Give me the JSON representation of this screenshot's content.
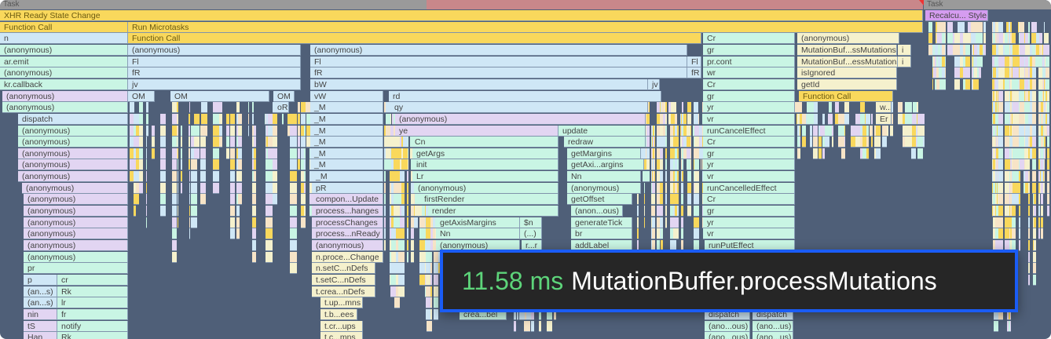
{
  "palette": {
    "yellow": "#f9d85c",
    "blue": "#cfe7f6",
    "green": "#c9f5e4",
    "purple": "#e2d5f2",
    "lightyellow": "#f5f1cd",
    "beige": "#f7e4c7",
    "background": "#4f5f78",
    "task_gray": "#9a9a9a",
    "long_task_red": "#c9878a",
    "style_purple": "#d59cf0",
    "tooltip_border": "#1a5cf5",
    "tooltip_time": "#5dd47a"
  },
  "task_row": {
    "left": "Task",
    "right": "Task"
  },
  "blocks": [
    "XHR Ready State Change",
    "Recalcu... Style",
    "Function Call",
    "Run Microtasks",
    "n",
    "Function Call",
    "Cr",
    "(anonymous)",
    "(anonymous)",
    "(anonymous)",
    "(anonymous)",
    "gr",
    "MutationBuf...ssMutations",
    "i",
    "ar.emit",
    "Fl",
    "Fl",
    "Fl",
    "pr.cont",
    "MutationBuf...essMutations",
    "i",
    "(anonymous)",
    "fR",
    "fR",
    "fR",
    "wr",
    "isIgnored",
    "kr.callback",
    "jv",
    "bW",
    "jv",
    "Cr",
    "getId",
    "(anonymous)",
    "OM",
    "OM",
    "OM",
    "vW",
    "rd",
    "gr",
    "Function Call",
    "(anonymous)",
    "oR",
    "_M",
    "qy",
    "yr",
    "w...",
    "dispatch",
    "_M",
    "(anonymous)",
    "vr",
    "Er",
    "(anonymous)",
    "_M",
    "ye",
    "update",
    "runCancelEffect",
    "(anonymous)",
    "_M",
    "Cn",
    "redraw",
    "Cr",
    "(anonymous)",
    "_M",
    "getArgs",
    "getMargins",
    "gr",
    "(anonymous)",
    "_M",
    "init",
    "getAxi...argins",
    "yr",
    "(anonymous)",
    "_M",
    "Lr",
    "Nn",
    "vr",
    "(anonymous)",
    "pR",
    "(anonymous)",
    "(anonymous)",
    "runCancelledEffect",
    "(anonymous)",
    "compon...Update",
    "firstRender",
    "getOffset",
    "Cr",
    "(anonymous)",
    "process...hanges",
    "render",
    "(anon...ous)",
    "gr",
    "(anonymous)",
    "processChanges",
    "getAxisMargins",
    "$n",
    "generateTick",
    "yr",
    "(anonymous)",
    "process...nReady",
    "Nn",
    "(...)",
    "br",
    "vr",
    "(anonymous)",
    "(anonymous)",
    "(anonymous)",
    "r...r",
    "addLabel",
    "runPutEffect",
    "(anonymous)",
    "n.proce...Change",
    "pr",
    "n.setC...nDefs",
    "p",
    "cr",
    "t.setC...nDefs",
    "(an...s)",
    "Rk",
    "t.crea...nDefs",
    "(an...s)",
    "lr",
    "t.up...mns",
    "nin",
    "fr",
    "t.b...ees",
    "crea...bel",
    "dispatch",
    "dispatch",
    "tS",
    "notify",
    "t.cr...ups",
    "(ano...ous)",
    "(ano...us)",
    "Han",
    "Rk",
    "t.c...mns",
    "(ano...ous)",
    "(ano...us)"
  ],
  "tooltip": {
    "duration": "11.58 ms",
    "name": "MutationBuffer.processMutations"
  }
}
